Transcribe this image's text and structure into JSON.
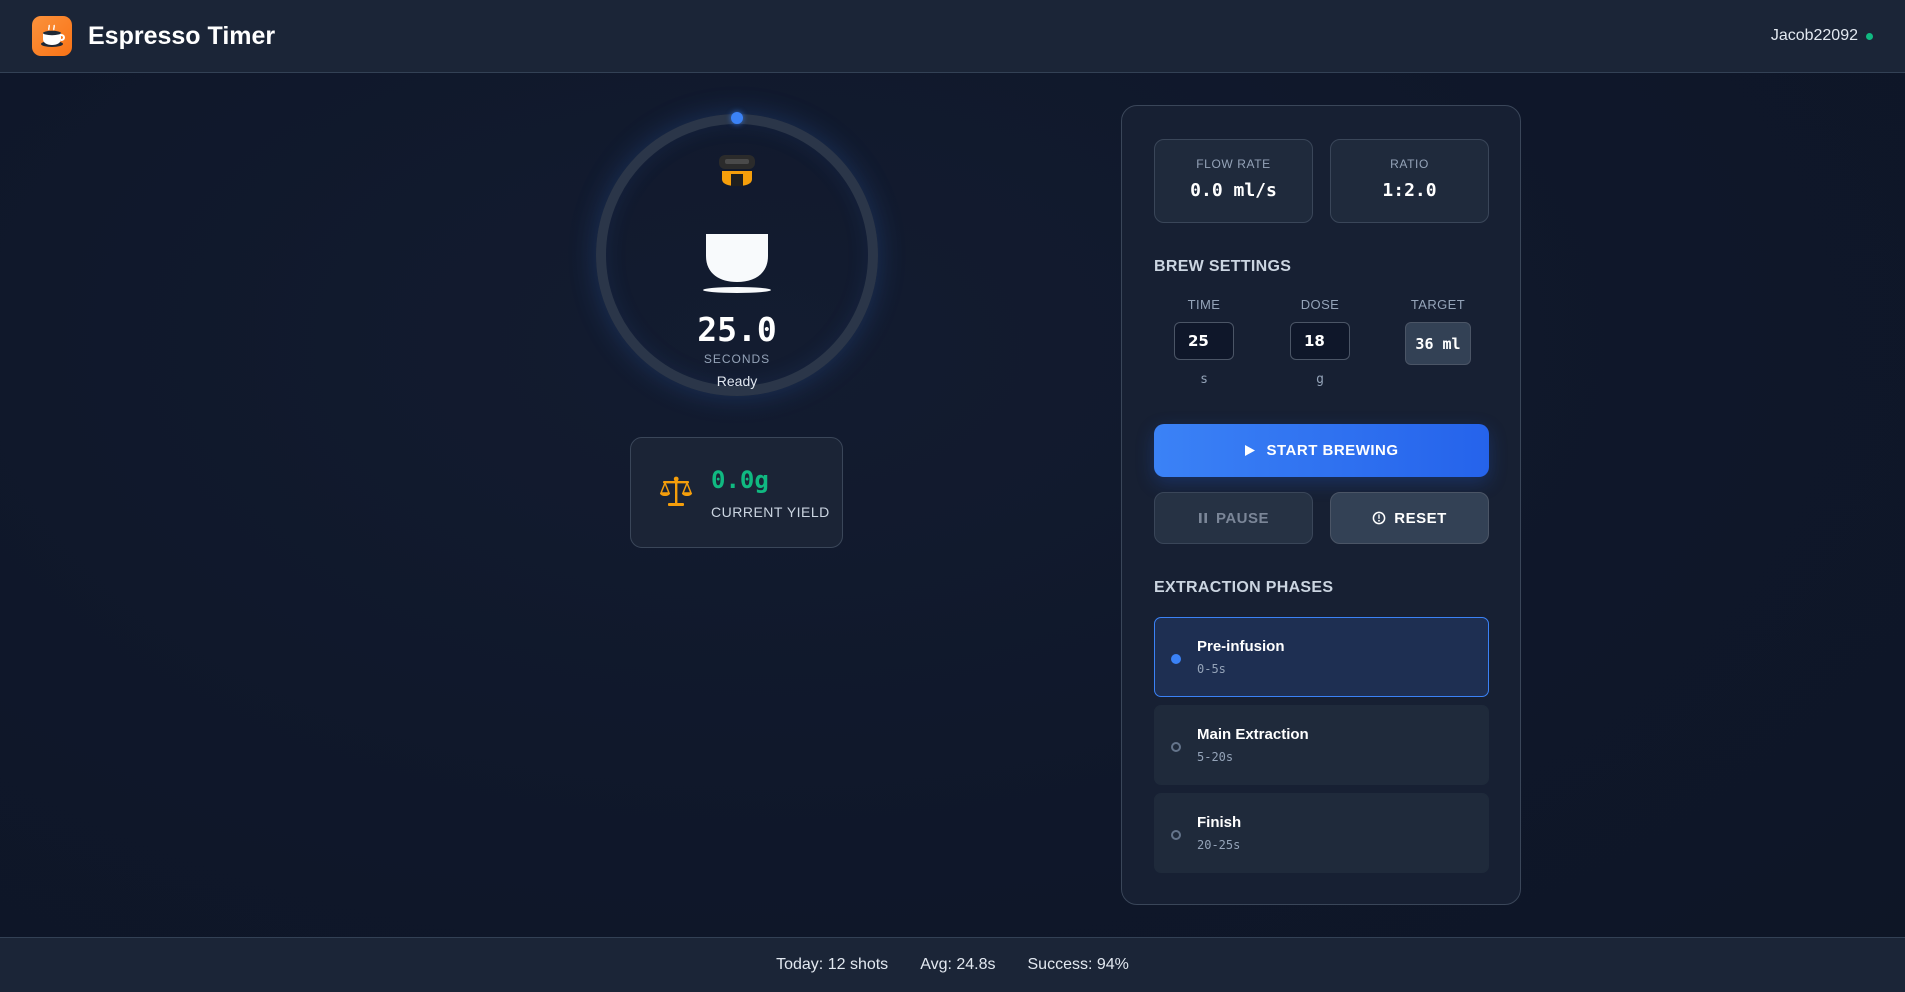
{
  "header": {
    "title": "Espresso Timer",
    "logo_icon": "coffee-cup-icon",
    "username": "Jacob22092",
    "status_color": "#10b981"
  },
  "timer": {
    "value": "25.0",
    "unit": "SECONDS",
    "status": "Ready",
    "progress": 0
  },
  "yield": {
    "value": "0.0g",
    "label": "CURRENT YIELD",
    "icon": "scale-icon"
  },
  "stats": [
    {
      "label": "FLOW RATE",
      "value": "0.0 ml/s"
    },
    {
      "label": "RATIO",
      "value": "1:2.0"
    }
  ],
  "brew_settings": {
    "title": "BREW SETTINGS",
    "time": {
      "label": "TIME",
      "value": "25",
      "unit": "s"
    },
    "dose": {
      "label": "DOSE",
      "value": "18",
      "unit": "g"
    },
    "target": {
      "label": "TARGET",
      "value": "36 ml"
    }
  },
  "controls": {
    "start_label": "START BREWING",
    "pause_label": "PAUSE",
    "reset_label": "RESET"
  },
  "phases": {
    "title": "EXTRACTION PHASES",
    "items": [
      {
        "name": "Pre-infusion",
        "range": "0-5s",
        "active": true
      },
      {
        "name": "Main Extraction",
        "range": "5-20s",
        "active": false
      },
      {
        "name": "Finish",
        "range": "20-25s",
        "active": false
      }
    ]
  },
  "footer": {
    "today": "Today: 12 shots",
    "avg": "Avg: 24.8s",
    "success": "Success: 94%"
  },
  "colors": {
    "accent": "#3b82f6",
    "brand": "#f97316",
    "success": "#10b981",
    "background": "#0f172a"
  }
}
